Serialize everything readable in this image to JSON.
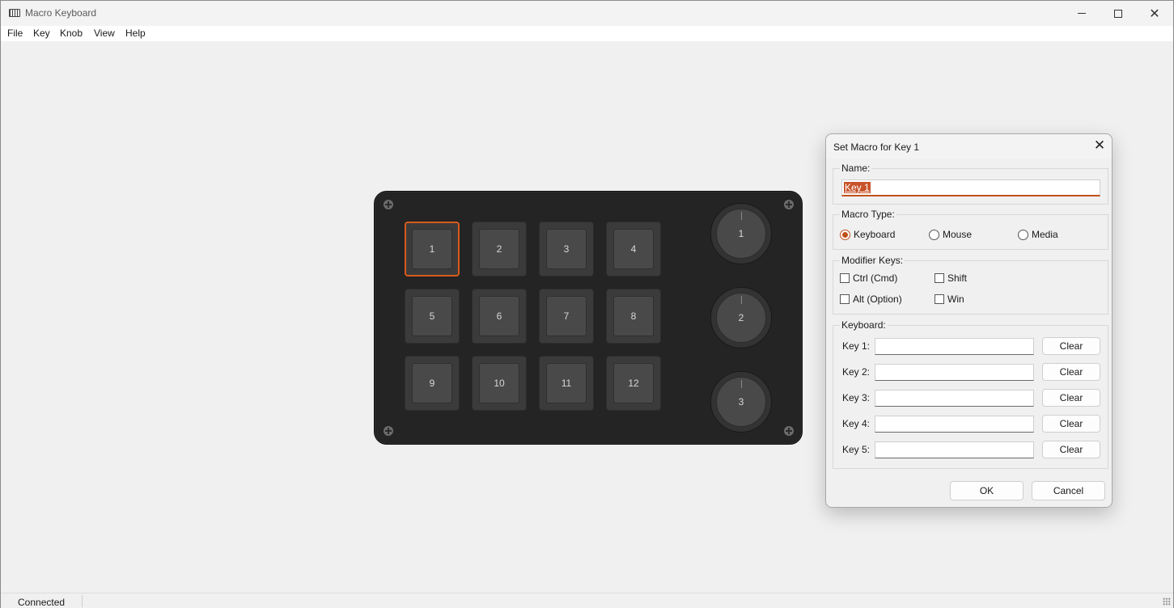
{
  "window": {
    "title": "Macro Keyboard"
  },
  "menu": [
    "File",
    "Key",
    "Knob",
    "View",
    "Help"
  ],
  "status": {
    "text": "Connected"
  },
  "device": {
    "keys": [
      "1",
      "2",
      "3",
      "4",
      "5",
      "6",
      "7",
      "8",
      "9",
      "10",
      "11",
      "12"
    ],
    "selected_key": "1",
    "knobs": [
      "1",
      "2",
      "3"
    ],
    "colors": {
      "body": "#242424",
      "selected": "#d75a1a"
    }
  },
  "dialog": {
    "title": "Set Macro for Key 1",
    "close_glyph": "✕",
    "name_group": {
      "label": "Name:",
      "value": "Key 1"
    },
    "macro_type": {
      "label": "Macro Type:",
      "options": [
        "Keyboard",
        "Mouse",
        "Media"
      ],
      "selected": "Keyboard"
    },
    "modifiers": {
      "label": "Modifier Keys:",
      "options": [
        "Ctrl (Cmd)",
        "Shift",
        "Alt (Option)",
        "Win"
      ]
    },
    "keyboard": {
      "label": "Keyboard:",
      "rows": [
        {
          "label": "Key 1:",
          "value": "",
          "clear": "Clear"
        },
        {
          "label": "Key 2:",
          "value": "",
          "clear": "Clear"
        },
        {
          "label": "Key 3:",
          "value": "",
          "clear": "Clear"
        },
        {
          "label": "Key 4:",
          "value": "",
          "clear": "Clear"
        },
        {
          "label": "Key 5:",
          "value": "",
          "clear": "Clear"
        }
      ]
    },
    "ok_label": "OK",
    "cancel_label": "Cancel",
    "accent": "#c0501a"
  }
}
